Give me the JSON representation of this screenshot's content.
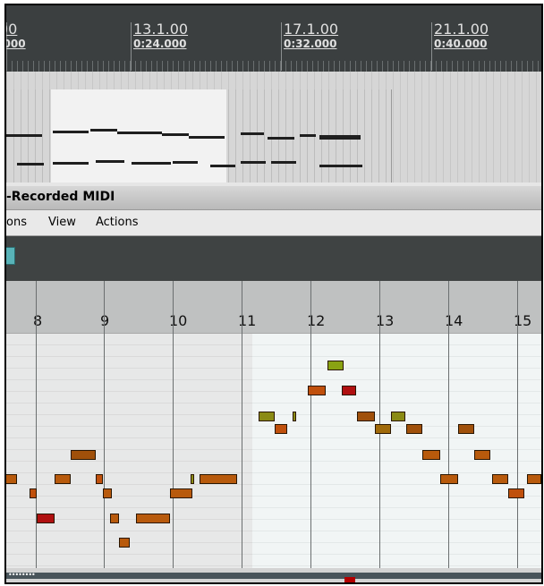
{
  "arrange_ruler": {
    "labels": [
      {
        "bar": "00",
        "time": ".000"
      },
      {
        "bar": "13.1.00",
        "time": "0:24.000"
      },
      {
        "bar": "17.1.00",
        "time": "0:32.000"
      },
      {
        "bar": "21.1.00",
        "time": "0:40.000"
      }
    ]
  },
  "editor": {
    "title": "-Recorded MIDI",
    "menu": [
      "ons",
      "View",
      "Actions"
    ]
  },
  "midi_ruler": {
    "measures": [
      "8",
      "9",
      "10",
      "11",
      "12",
      "13",
      "14",
      "15"
    ]
  },
  "colors": {
    "note_orange": "#b85a0c",
    "note_olive": "#8b8b14",
    "note_red": "#b01010",
    "note_green": "#8aa313",
    "toolbar": "#3f4343",
    "ruler": "#3b3f40"
  }
}
